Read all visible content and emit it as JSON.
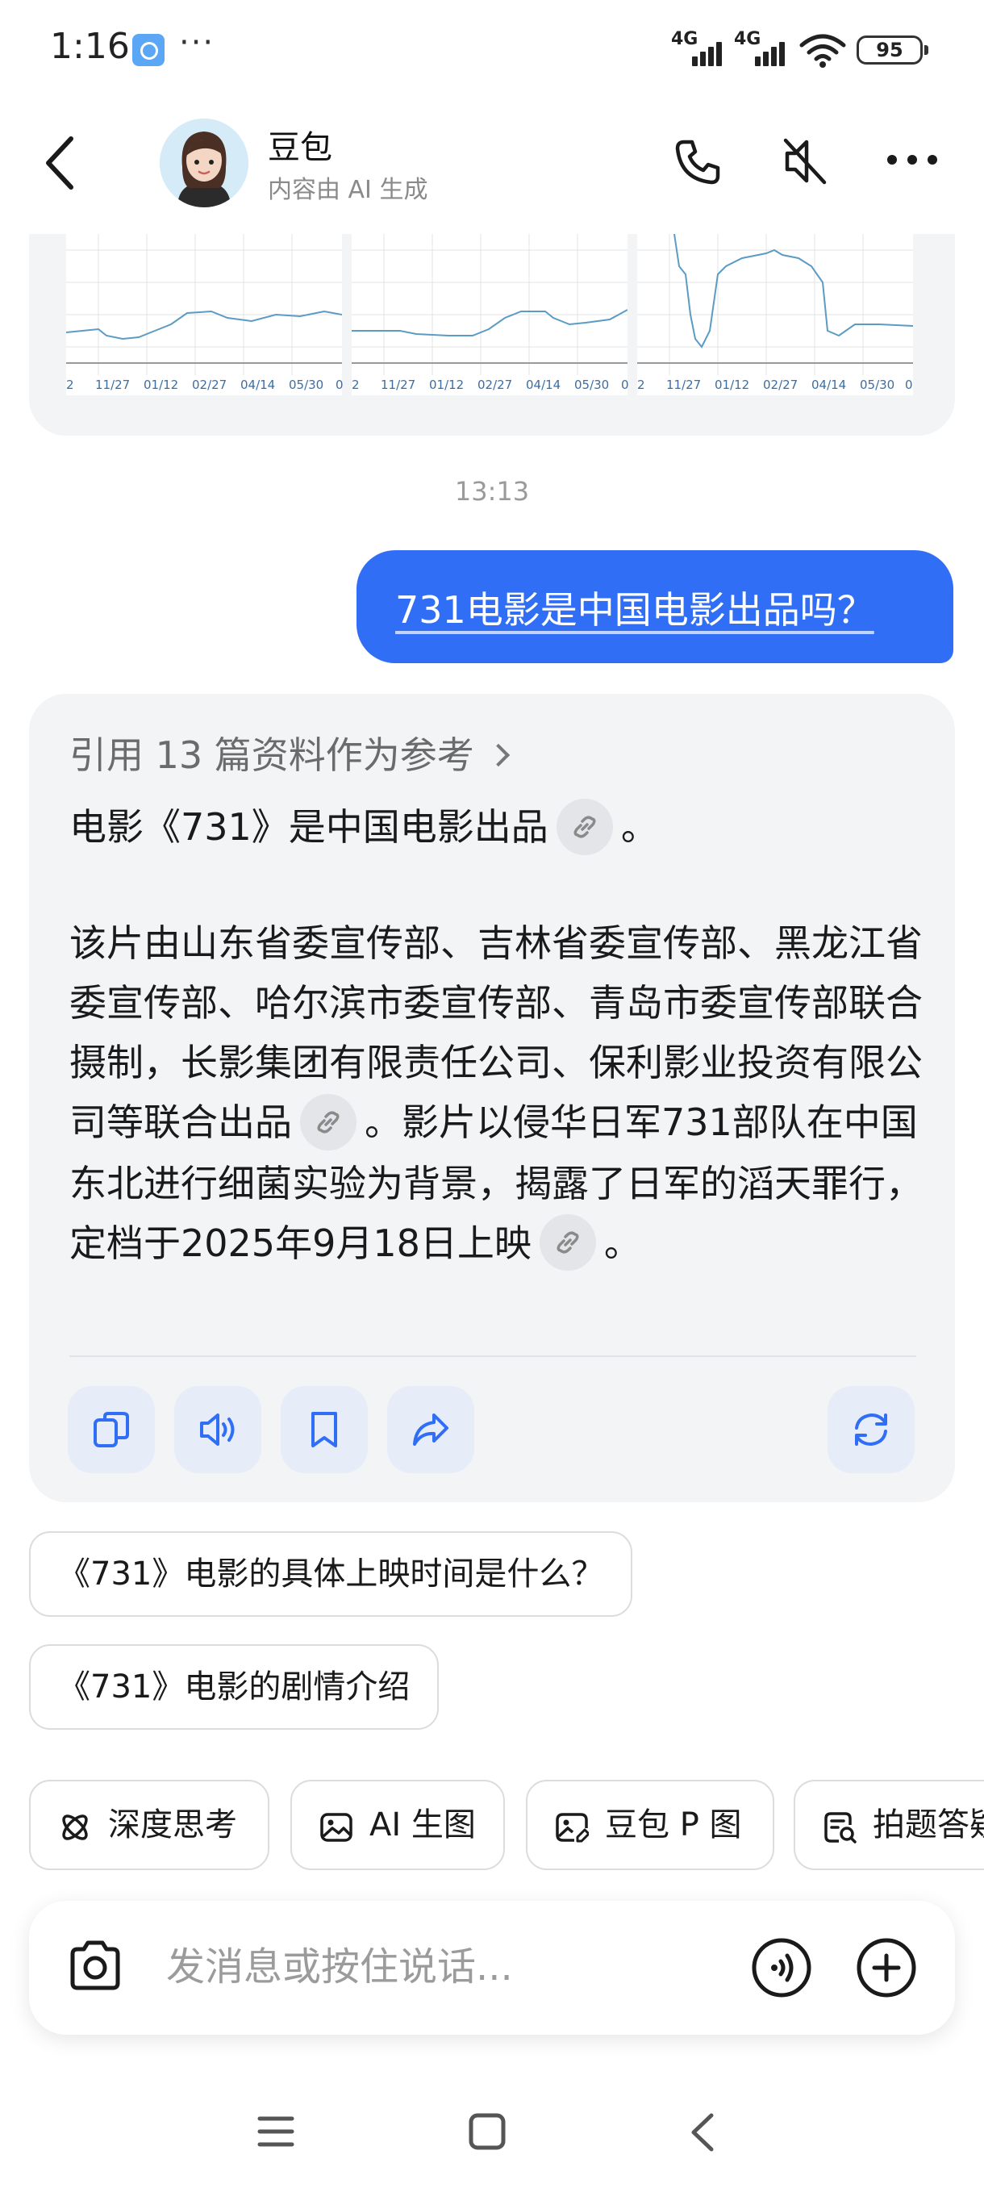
{
  "status_bar": {
    "time": "1:16",
    "more": "···",
    "signal1": "4G",
    "signal2": "4G",
    "battery": "95"
  },
  "header": {
    "bot_name": "豆包",
    "bot_subtitle": "内容由 AI 生成"
  },
  "prev_card": {
    "charts": [
      {
        "ticks": [
          "2",
          "11/27",
          "01/12",
          "02/27",
          "04/14",
          "05/30",
          "0"
        ]
      },
      {
        "ticks": [
          "2",
          "11/27",
          "01/12",
          "02/27",
          "04/14",
          "05/30",
          "0"
        ]
      },
      {
        "ticks": [
          "2",
          "11/27",
          "01/12",
          "02/27",
          "04/14",
          "05/30",
          "0"
        ]
      }
    ]
  },
  "timestamp": "13:13",
  "user_message": "731电影是中国电影出品吗？",
  "answer": {
    "references": "引用 13 篇资料作为参考",
    "para1": "电影《731》是中国电影出品",
    "para1_end": "。",
    "para2_a": "该片由山东省委宣传部、吉林省委宣传部、黑龙江省委宣传部、哈尔滨市委宣传部、青岛市委宣传部联合摄制，长影集团有限责任公司、保利影业投资有限公司等联合出品",
    "para2_b": "。影片以侵华日军731部队在中国东北进行细菌实验为背景，揭露了日军的滔天罪行，定档于2025年9月18日上映",
    "para2_end": "。"
  },
  "suggestions": [
    "《731》电影的具体上映时间是什么？",
    "《731》电影的剧情介绍"
  ],
  "tools": [
    "深度思考",
    "AI 生图",
    "豆包 P 图",
    "拍题答疑"
  ],
  "input": {
    "placeholder": "发消息或按住说话..."
  },
  "colors": {
    "accent": "#2f6ef5",
    "card_bg": "#f3f4f6",
    "icon_blue": "#2f6ef5"
  },
  "icons": [
    "back-icon",
    "phone-icon",
    "mute-icon",
    "more-icon",
    "link-icon",
    "copy-icon",
    "speaker-icon",
    "bookmark-icon",
    "share-icon",
    "refresh-icon",
    "atom-icon",
    "image-icon",
    "image-edit-icon",
    "question-scan-icon",
    "camera-icon",
    "voice-icon",
    "plus-icon",
    "menu-icon",
    "home-icon"
  ]
}
